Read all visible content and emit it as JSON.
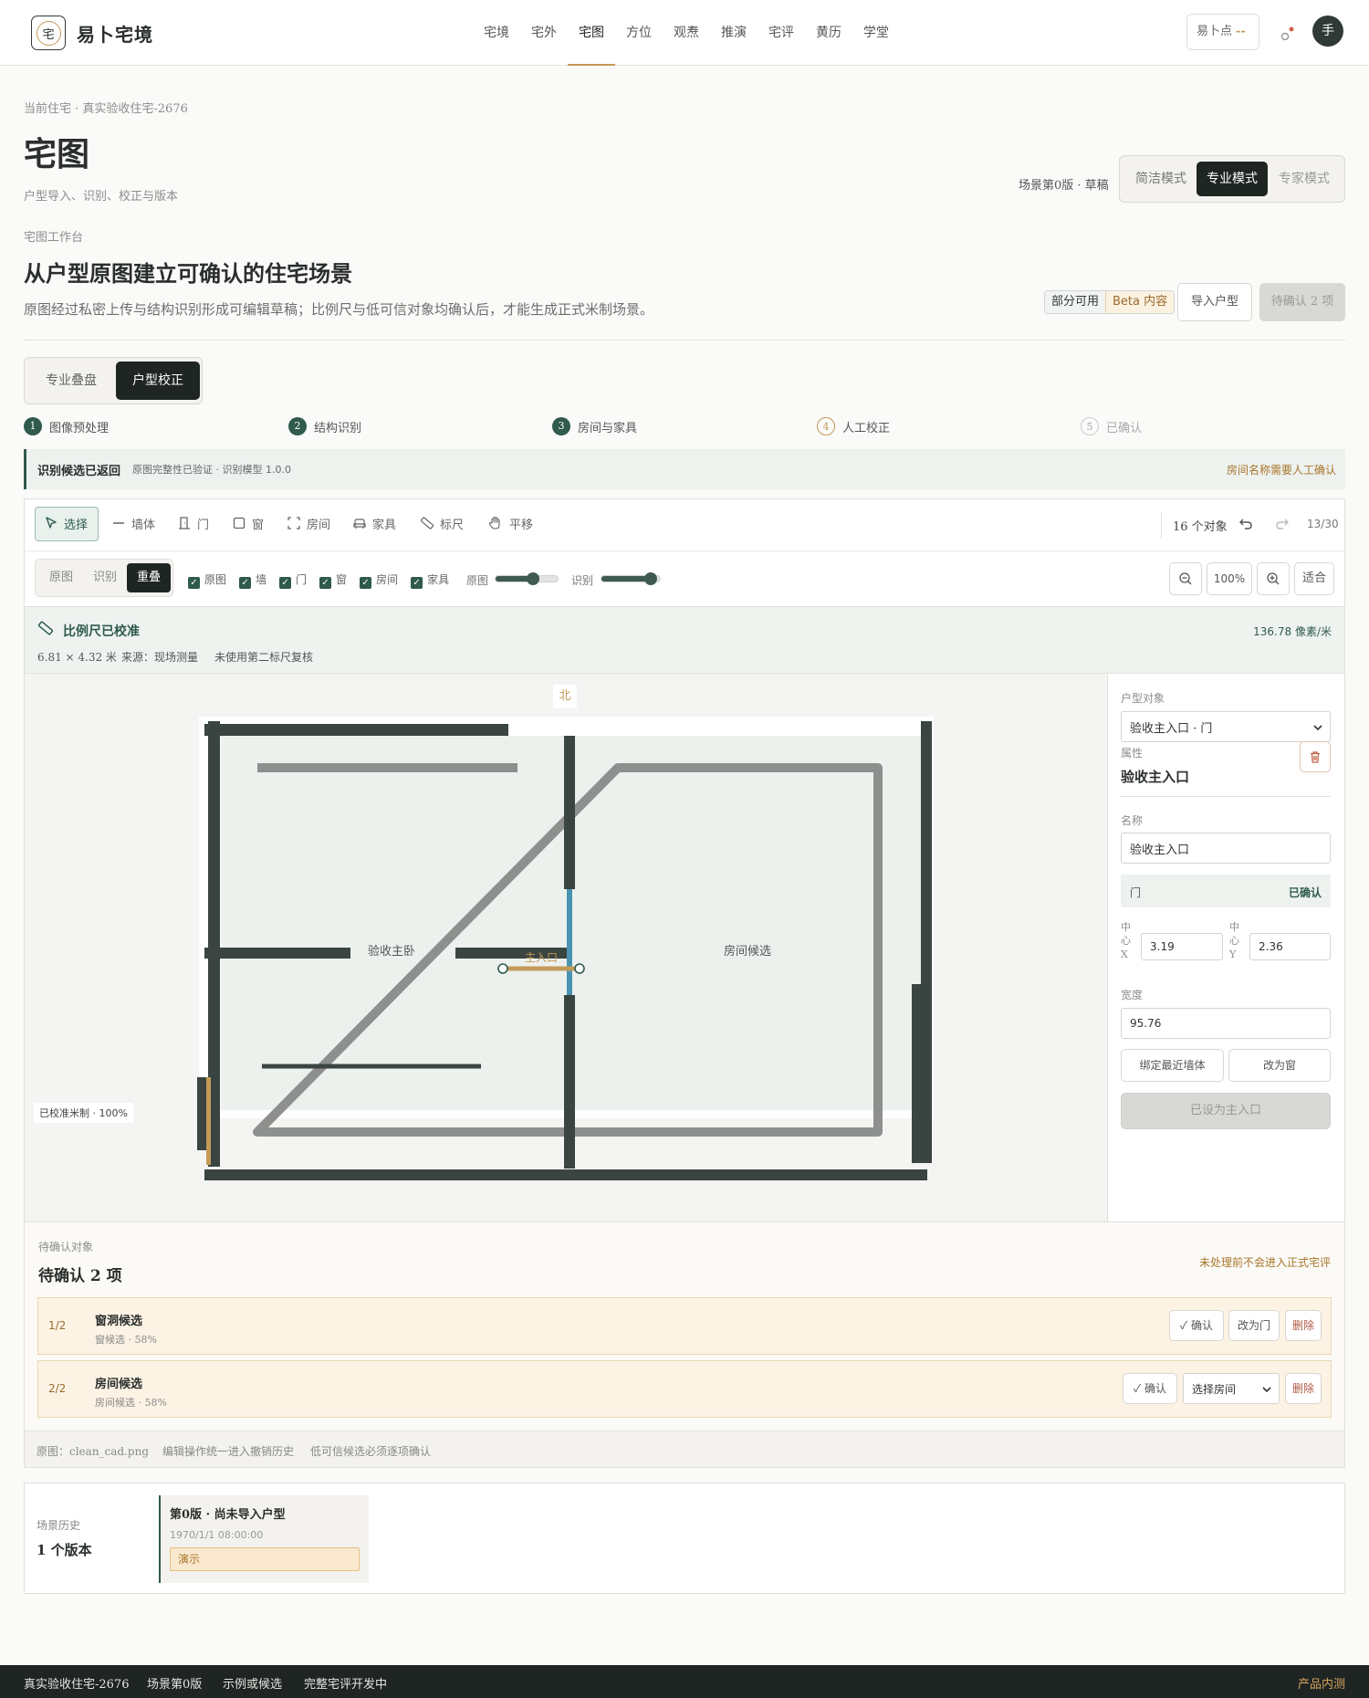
{
  "header": {
    "logo_char": "宅",
    "brand": "易卜宅境",
    "nav": [
      "宅境",
      "宅外",
      "宅图",
      "方位",
      "观焘",
      "推演",
      "宅评",
      "黄历",
      "学堂"
    ],
    "nav_active_index": 2,
    "points_label": "易卜点",
    "points_value": "--",
    "avatar": "手"
  },
  "page": {
    "breadcrumb": "当前住宅 · 真实验收住宅-2676",
    "title": "宅图",
    "subtitle": "户型导入、识别、校正与版本",
    "scene_status": "场景第0版 · 草稿",
    "modes": [
      "简洁模式",
      "专业模式",
      "专家模式"
    ],
    "mode_active_index": 1
  },
  "workbench": {
    "eyebrow": "宅图工作台",
    "title": "从户型原图建立可确认的住宅场景",
    "desc": "原图经过私密上传与结构识别形成可编辑草稿；比例尺与低可信对象均确认后，才能生成正式米制场景。",
    "badge_partial": "部分可用",
    "badge_beta": "Beta 内容",
    "import_btn": "导入户型",
    "pending_btn": "待确认 2 项",
    "tabs": [
      "专业叠盘",
      "户型校正"
    ],
    "tab_active_index": 1
  },
  "steps": [
    {
      "num": "1",
      "label": "图像预处理",
      "state": "done"
    },
    {
      "num": "2",
      "label": "结构识别",
      "state": "done"
    },
    {
      "num": "3",
      "label": "房间与家具",
      "state": "done"
    },
    {
      "num": "4",
      "label": "人工校正",
      "state": "current"
    },
    {
      "num": "5",
      "label": "已确认",
      "state": "todo"
    }
  ],
  "notice": {
    "title": "识别候选已返回",
    "detail": "原图完整性已验证 · 识别模型 1.0.0",
    "right": "房间名称需要人工确认"
  },
  "toolbar": {
    "tools": [
      {
        "label": "选择",
        "icon": "cursor-icon"
      },
      {
        "label": "墙体",
        "icon": "wall-icon"
      },
      {
        "label": "门",
        "icon": "door-icon"
      },
      {
        "label": "窗",
        "icon": "window-icon"
      },
      {
        "label": "房间",
        "icon": "room-icon"
      },
      {
        "label": "家具",
        "icon": "furniture-icon"
      },
      {
        "label": "标尺",
        "icon": "ruler-icon"
      },
      {
        "label": "平移",
        "icon": "hand-icon"
      }
    ],
    "object_count": "16 个对象",
    "history": "13/30"
  },
  "view": {
    "modes": [
      "原图",
      "识别",
      "重叠"
    ],
    "mode_active_index": 2,
    "layers": [
      "原图",
      "墙",
      "门",
      "窗",
      "房间",
      "家具"
    ],
    "slider_original_label": "原图",
    "slider_original_value": 0.6,
    "slider_recog_label": "识别",
    "slider_recog_value": 0.85,
    "zoom": "100%",
    "fit": "适合"
  },
  "scale": {
    "title": "比例尺已校准",
    "dimensions": "6.81 × 4.32 米",
    "source": "来源：现场测量",
    "note": "未使用第二标尺复核",
    "ratio": "136.78 像素/米"
  },
  "canvas": {
    "north": "北",
    "room_left": "验收主卧",
    "room_right": "房间候选",
    "door_label": "主入口",
    "status": "已校准米制 · 100%"
  },
  "props": {
    "section": "户型对象",
    "selected": "验收主入口 · 门",
    "attr_label": "属性",
    "attr_name": "验收主入口",
    "name_label": "名称",
    "name_value": "验收主入口",
    "type": "门",
    "type_status": "已确认",
    "cx_label": "中心X",
    "cx_value": "3.19",
    "cy_label": "中心Y",
    "cy_value": "2.36",
    "width_label": "宽度",
    "width_value": "95.76",
    "bind_wall": "绑定最近墙体",
    "to_window": "改为窗",
    "main_entry": "已设为主入口"
  },
  "pending": {
    "eyebrow": "待确认对象",
    "title": "待确认 2 项",
    "note": "未处理前不会进入正式宅评",
    "items": [
      {
        "index": "1/2",
        "title": "窗洞候选",
        "sub": "窗候选 · 58%",
        "confirm": "确认",
        "alt": "改为门",
        "delete": "删除"
      },
      {
        "index": "2/2",
        "title": "房间候选",
        "sub": "房间候选 · 58%",
        "confirm": "确认",
        "select": "选择房间",
        "delete": "删除"
      }
    ],
    "footer": [
      "原图：clean_cad.png",
      "编辑操作统一进入撤销历史",
      "低可信候选必须逐项确认"
    ]
  },
  "history": {
    "label": "场景历史",
    "count": "1 个版本",
    "version_title": "第0版 · 尚未导入户型",
    "version_time": "1970/1/1 08:00:00",
    "version_tag": "演示"
  },
  "footer": {
    "items": [
      "真实验收住宅-2676",
      "场景第0版",
      "示例或候选",
      "完整宅评开发中"
    ],
    "right": "产品内测"
  },
  "colors": {
    "accent": "#c49a59",
    "primary": "#2f3a36",
    "green": "#2f5a4d",
    "door": "#4a94b0"
  }
}
